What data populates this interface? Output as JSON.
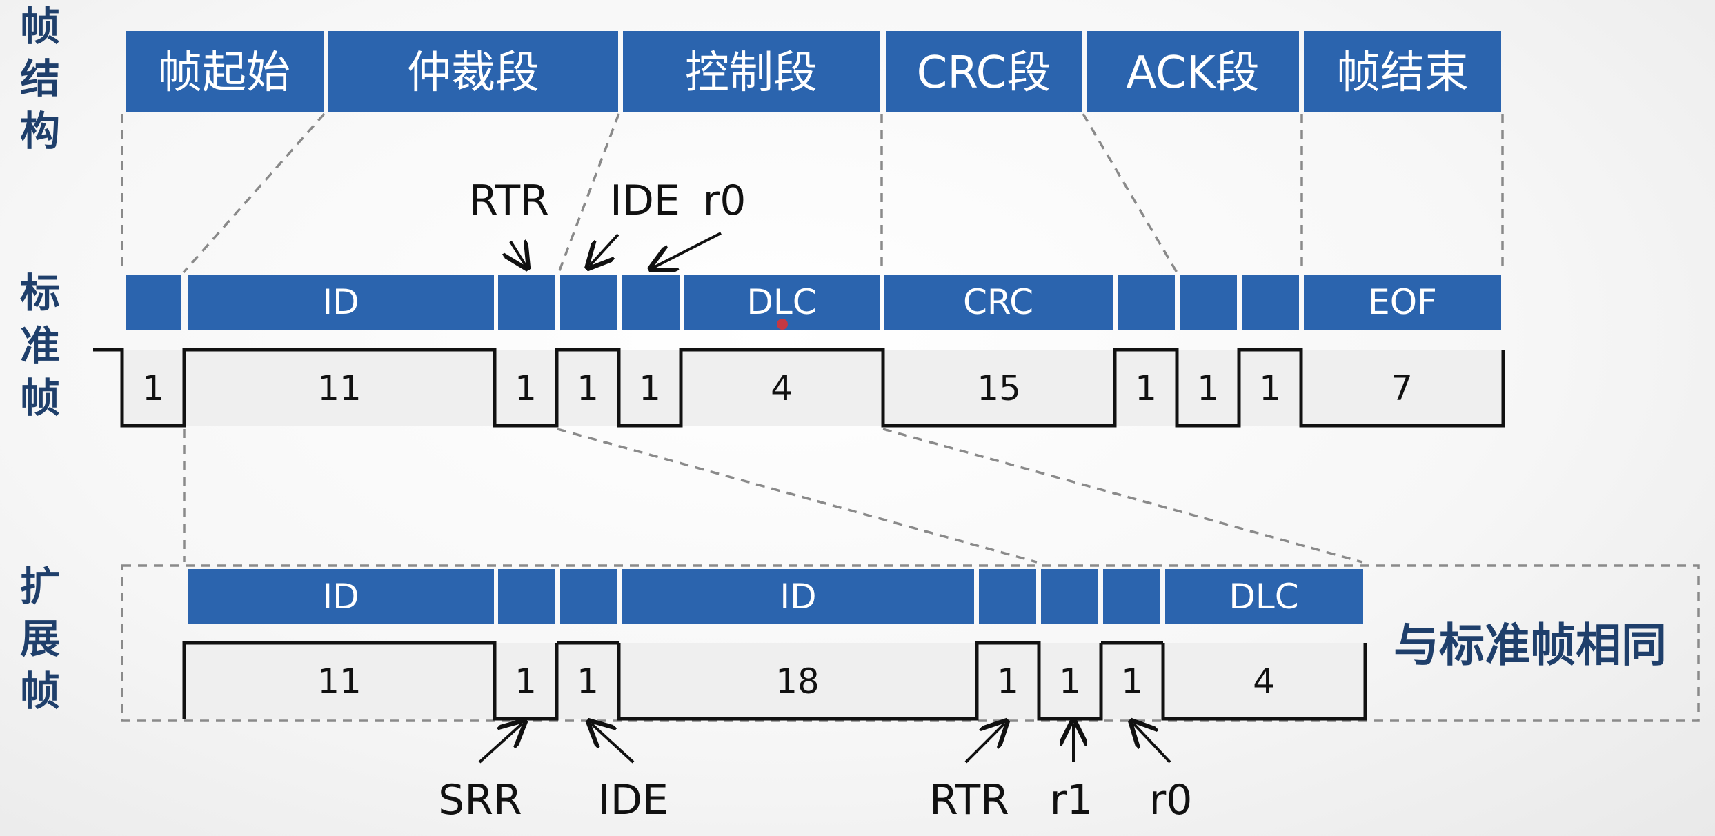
{
  "labels": {
    "frame_structure": [
      "帧",
      "结",
      "构"
    ],
    "standard_frame": [
      "标",
      "准",
      "帧"
    ],
    "extended_frame": [
      "扩",
      "展",
      "帧"
    ]
  },
  "sections": [
    {
      "key": "sof",
      "label": "帧起始"
    },
    {
      "key": "arbitration",
      "label": "仲裁段"
    },
    {
      "key": "control",
      "label": "控制段"
    },
    {
      "key": "crc",
      "label": "CRC段"
    },
    {
      "key": "ack",
      "label": "ACK段"
    },
    {
      "key": "eof",
      "label": "帧结束"
    }
  ],
  "standard": {
    "fields": [
      {
        "label": "",
        "bits": "1"
      },
      {
        "label": "ID",
        "bits": "11"
      },
      {
        "label": "",
        "bits": "1"
      },
      {
        "label": "",
        "bits": "1"
      },
      {
        "label": "",
        "bits": "1"
      },
      {
        "label": "DLC",
        "bits": "4"
      },
      {
        "label": "CRC",
        "bits": "15"
      },
      {
        "label": "",
        "bits": "1"
      },
      {
        "label": "",
        "bits": "1"
      },
      {
        "label": "",
        "bits": "1"
      },
      {
        "label": "EOF",
        "bits": "7"
      }
    ],
    "annotations": {
      "rtr": "RTR",
      "ide": "IDE",
      "r0": "r0"
    }
  },
  "extended": {
    "fields": [
      {
        "label": "ID",
        "bits": "11"
      },
      {
        "label": "",
        "bits": "1"
      },
      {
        "label": "",
        "bits": "1"
      },
      {
        "label": "ID",
        "bits": "18"
      },
      {
        "label": "",
        "bits": "1"
      },
      {
        "label": "",
        "bits": "1"
      },
      {
        "label": "",
        "bits": "1"
      },
      {
        "label": "DLC",
        "bits": "4"
      }
    ],
    "annotations": {
      "srr": "SRR",
      "ide": "IDE",
      "rtr": "RTR",
      "r1": "r1",
      "r0": "r0"
    },
    "same_as_standard": "与标准帧相同"
  },
  "colors": {
    "blue": "#2b64ae",
    "label": "#1f3f6b",
    "cell": "#efefef",
    "dashed": "#8a8a8a"
  }
}
